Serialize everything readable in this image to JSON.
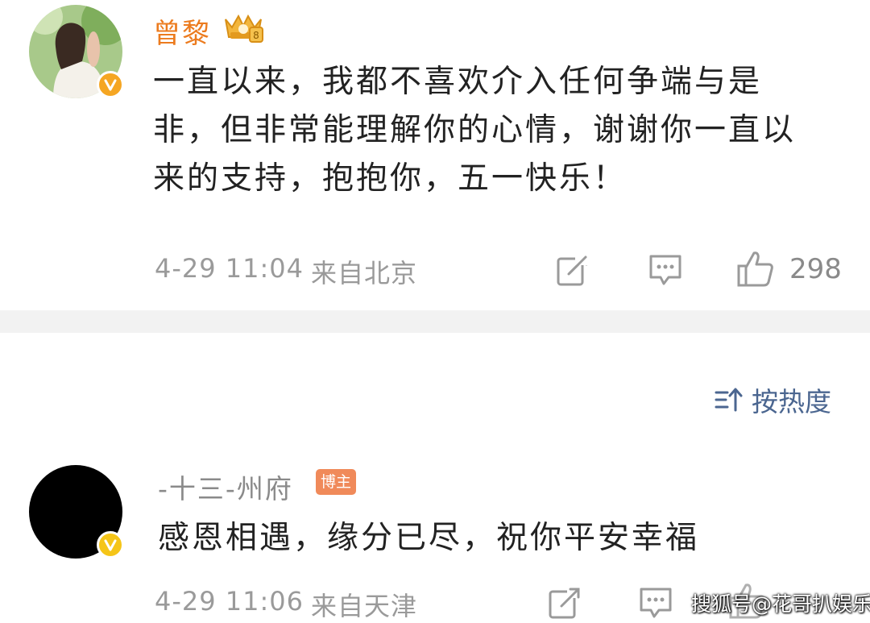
{
  "post": {
    "author": "曾黎",
    "text": "一直以来，我都不喜欢介入任何争端与是非，但非常能理解你的心情，谢谢你一直以来的支持，抱抱你，五一快乐！",
    "time": "4-29 11:04",
    "location": "来自北京",
    "like_count": "298",
    "icons": [
      "repost-icon",
      "comment-icon",
      "like-icon"
    ]
  },
  "sort": {
    "label": "按热度",
    "icon": "sort-icon"
  },
  "comment": {
    "author": "-十三-州府",
    "tag": "博主",
    "text": "感恩相遇，缘分已尽，祝你平安幸福",
    "time": "4-29 11:06",
    "location": "来自天津"
  },
  "watermark": "搜狐号@花哥扒娱乐",
  "colors": {
    "username": "#ec7b1e",
    "meta": "#9a9a9a",
    "sort": "#4b6690",
    "badge": "#f5a623",
    "tag": "#f08a5a"
  }
}
